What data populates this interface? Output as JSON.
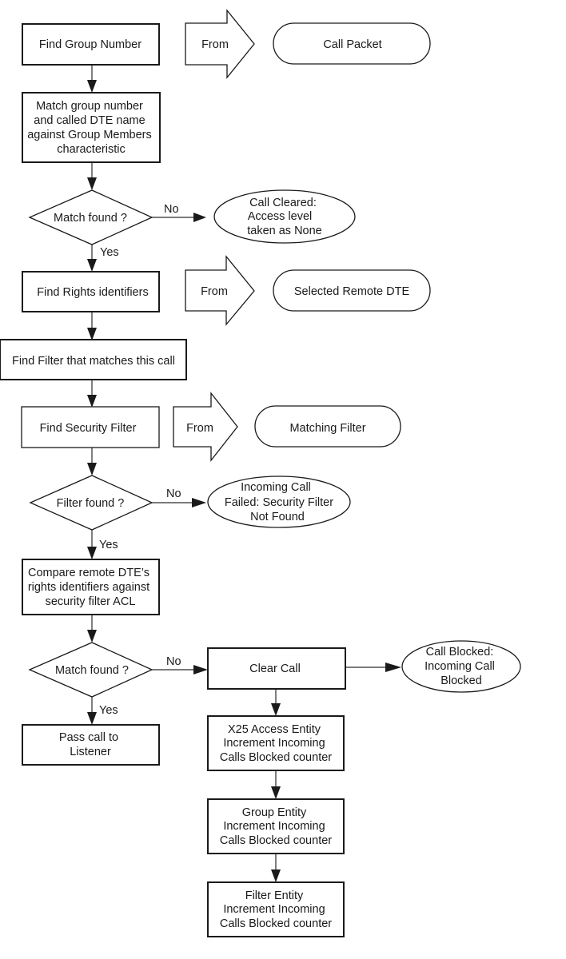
{
  "diagram": {
    "type": "flowchart",
    "nodes": {
      "find_group_number": "Find Group Number",
      "from_1": "From",
      "call_packet": "Call Packet",
      "match_group": [
        "Match group number",
        "and called DTE name",
        "against Group Members",
        "characteristic"
      ],
      "match_found_1": "Match found ?",
      "call_cleared": [
        "Call Cleared:",
        "Access level",
        "taken as None"
      ],
      "find_rights": "Find Rights identifiers",
      "from_2": "From",
      "selected_remote_dte": "Selected Remote DTE",
      "find_filter": "Find Filter that matches this call",
      "find_security_filter": "Find Security Filter",
      "from_3": "From",
      "matching_filter": "Matching Filter",
      "filter_found": "Filter found ?",
      "incoming_failed": [
        "Incoming Call",
        "Failed:  Security Filter",
        "Not Found"
      ],
      "compare_remote": [
        "Compare remote DTE’s",
        "rights identifiers against",
        "security filter ACL"
      ],
      "match_found_2": "Match found ?",
      "clear_call": "Clear Call",
      "call_blocked": [
        "Call Blocked:",
        "Incoming Call",
        "Blocked"
      ],
      "pass_call": [
        "Pass call to",
        "Listener"
      ],
      "x25_entity": [
        "X25 Access Entity",
        "Increment Incoming",
        "Calls Blocked counter"
      ],
      "group_entity": [
        "Group Entity",
        "Increment Incoming",
        "Calls Blocked counter"
      ],
      "filter_entity": [
        "Filter Entity",
        "Increment Incoming",
        "Calls Blocked counter"
      ]
    },
    "edge_labels": {
      "no_1": "No",
      "yes_1": "Yes",
      "no_2": "No",
      "yes_2": "Yes",
      "no_3": "No",
      "yes_3": "Yes"
    },
    "edges": [
      [
        "find_group_number",
        "match_group"
      ],
      [
        "match_group",
        "match_found_1"
      ],
      [
        "match_found_1",
        "call_cleared",
        "No"
      ],
      [
        "match_found_1",
        "find_rights",
        "Yes"
      ],
      [
        "find_rights",
        "find_filter"
      ],
      [
        "find_filter",
        "find_security_filter"
      ],
      [
        "find_security_filter",
        "filter_found"
      ],
      [
        "filter_found",
        "incoming_failed",
        "No"
      ],
      [
        "filter_found",
        "compare_remote",
        "Yes"
      ],
      [
        "compare_remote",
        "match_found_2"
      ],
      [
        "match_found_2",
        "clear_call",
        "No"
      ],
      [
        "match_found_2",
        "pass_call",
        "Yes"
      ],
      [
        "clear_call",
        "call_blocked"
      ],
      [
        "clear_call",
        "x25_entity"
      ],
      [
        "x25_entity",
        "group_entity"
      ],
      [
        "group_entity",
        "filter_entity"
      ]
    ]
  }
}
